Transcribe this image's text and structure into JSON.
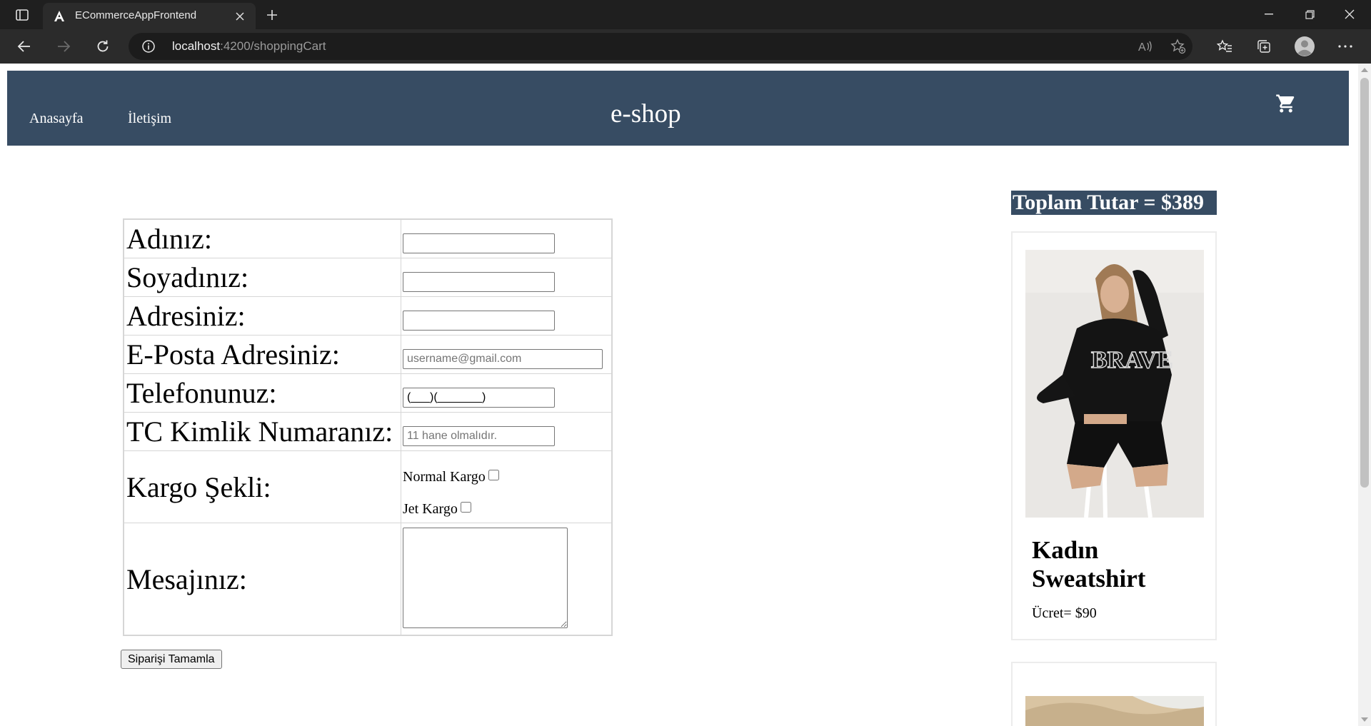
{
  "browser": {
    "tab_title": "ECommerceAppFrontend",
    "url_host": "localhost",
    "url_rest": ":4200/shoppingCart"
  },
  "header": {
    "nav": [
      "Anasayfa",
      "İletişim"
    ],
    "brand": "e-shop"
  },
  "form": {
    "rows": [
      {
        "label": "Adınız:",
        "value": "",
        "placeholder": ""
      },
      {
        "label": "Soyadınız:",
        "value": "",
        "placeholder": ""
      },
      {
        "label": "Adresiniz:",
        "value": "",
        "placeholder": ""
      },
      {
        "label": "E-Posta Adresiniz:",
        "value": "",
        "placeholder": "username@gmail.com"
      },
      {
        "label": "Telefonunuz:",
        "value": "(___)(_______)",
        "placeholder": ""
      },
      {
        "label": "TC Kimlik Numaranız:",
        "value": "",
        "placeholder": "11 hane olmalıdır."
      }
    ],
    "shipping_label": "Kargo Şekli:",
    "shipping_options": [
      "Normal Kargo",
      "Jet Kargo"
    ],
    "message_label": "Mesajınız:",
    "submit_label": "Siparişi Tamamla"
  },
  "cart": {
    "total": "Toplam Tutar = $389",
    "products": [
      {
        "name": "Kadın Sweatshirt",
        "price": "Ücret= $90"
      }
    ]
  },
  "colors": {
    "header_bg": "#374c63",
    "chrome_dark": "#1f1f1f",
    "chrome_toolbar": "#2b2b2b"
  }
}
